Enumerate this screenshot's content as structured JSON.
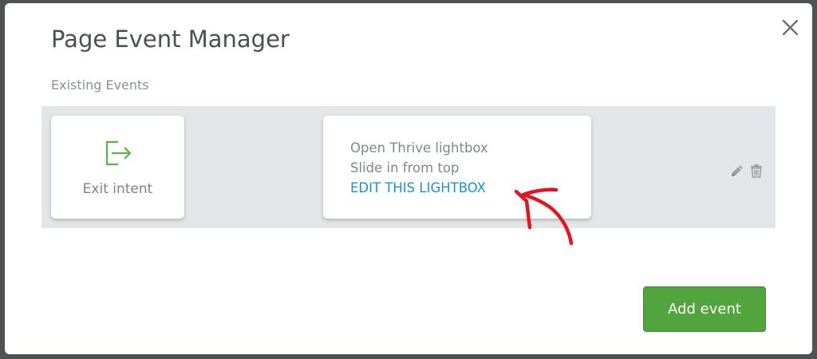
{
  "dialog": {
    "title": "Page Event Manager",
    "section_label": "Existing Events",
    "close_icon": "close-icon"
  },
  "events": [
    {
      "trigger": {
        "icon": "exit-icon",
        "label": "Exit intent"
      },
      "action": {
        "line1": "Open Thrive lightbox",
        "line2": "Slide in from top",
        "link": "EDIT THIS LIGHTBOX"
      },
      "row_actions": [
        "edit-icon",
        "delete-icon"
      ]
    }
  ],
  "footer": {
    "add_event_label": "Add event"
  },
  "colors": {
    "accent_green": "#51a53c",
    "link_blue": "#1b93cf",
    "annotation_red": "#e5141d",
    "icon_green": "#5bb04a"
  }
}
